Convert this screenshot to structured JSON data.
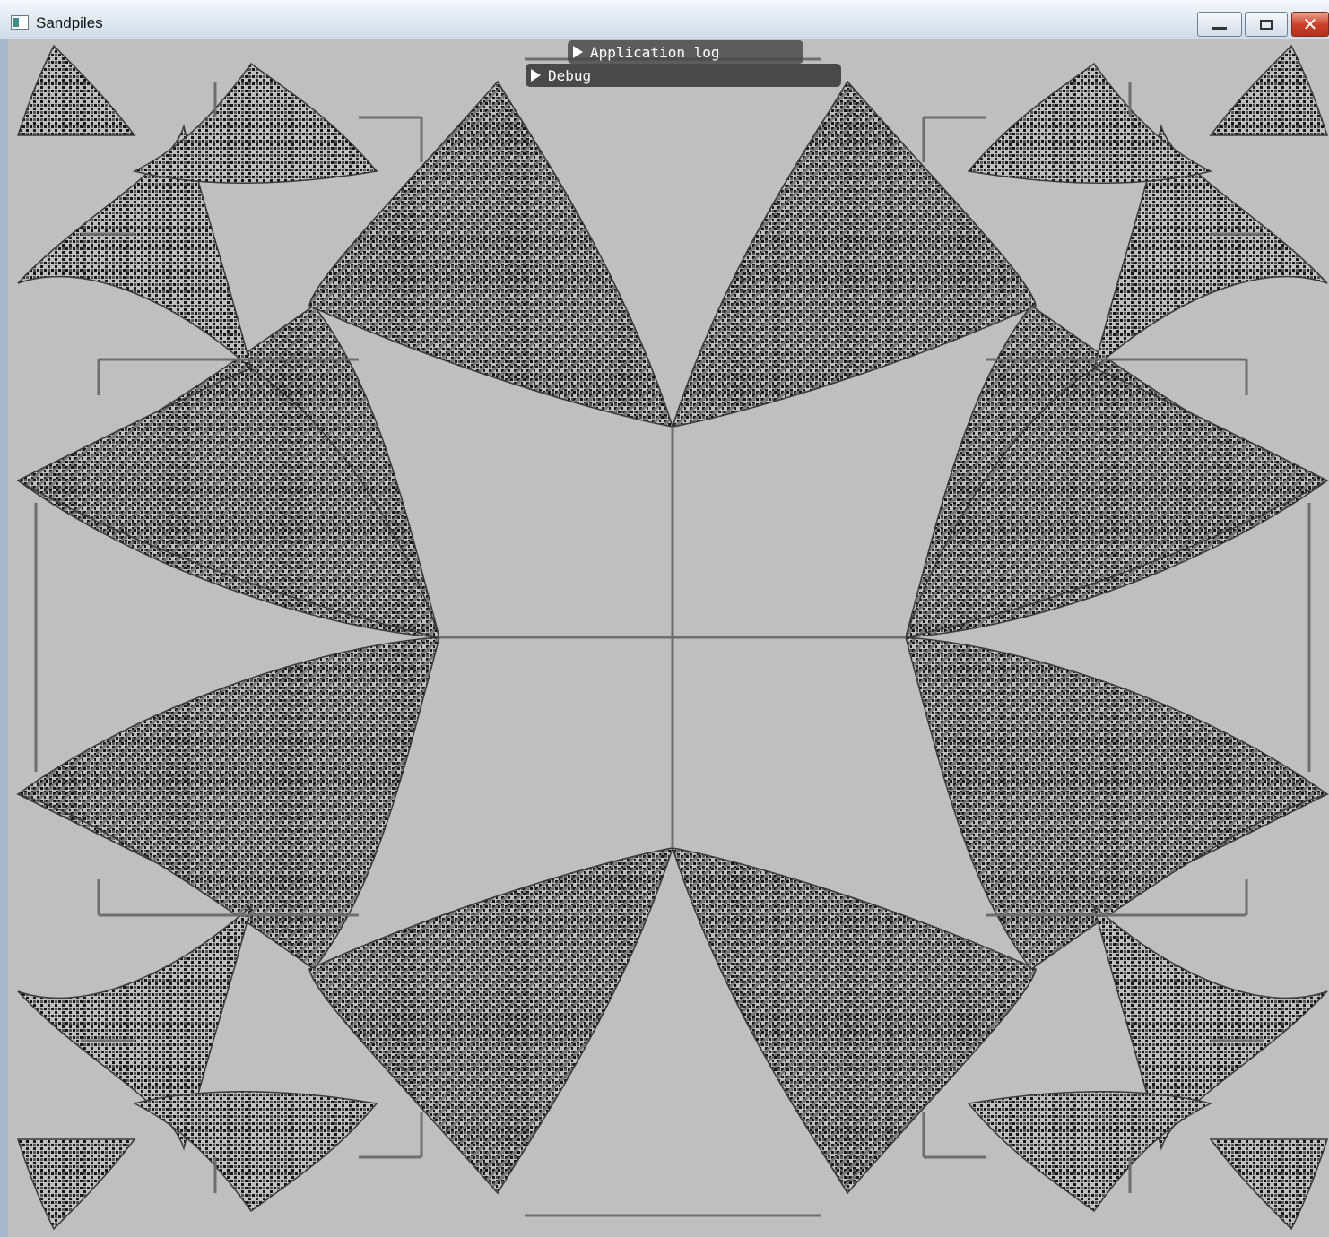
{
  "window": {
    "title": "Sandpiles",
    "icon": "app-window-icon",
    "controls": {
      "minimize": "minimize-icon",
      "maximize": "maximize-icon",
      "close": "close-icon",
      "close_glyph": "✕"
    }
  },
  "panels": {
    "application_log": {
      "label": "Application log",
      "state": "collapsed"
    },
    "debug": {
      "label": "Debug",
      "state": "collapsed"
    }
  },
  "canvas": {
    "content": "sandpile fractal",
    "colors": {
      "background": "#bfbfbf",
      "grains": "#111111",
      "lines": "#6e6e6e",
      "mid": "#7a7a7a"
    }
  }
}
